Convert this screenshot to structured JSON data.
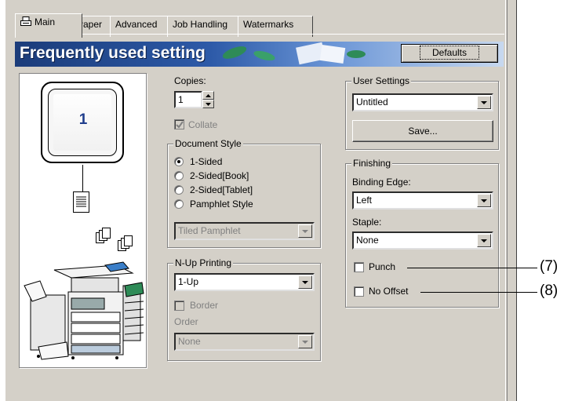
{
  "tabs": [
    {
      "label": "Main",
      "active": true
    },
    {
      "label": "Paper"
    },
    {
      "label": "Advanced"
    },
    {
      "label": "Job Handling"
    },
    {
      "label": "Watermarks"
    }
  ],
  "banner": {
    "title": "Frequently used setting",
    "defaults_label": "Defaults"
  },
  "preview": {
    "page_number": "1"
  },
  "copies": {
    "label": "Copies:",
    "value": "1"
  },
  "collate": {
    "label": "Collate",
    "checked": true,
    "enabled": false
  },
  "document_style": {
    "legend": "Document Style",
    "options": [
      "1-Sided",
      "2-Sided[Book]",
      "2-Sided[Tablet]",
      "Pamphlet Style"
    ],
    "selected": "1-Sided",
    "pamphlet_value": "Tiled Pamphlet"
  },
  "nup": {
    "legend": "N-Up Printing",
    "value": "1-Up",
    "border_label": "Border",
    "order_label": "Order",
    "order_value": "None"
  },
  "user_settings": {
    "legend": "User Settings",
    "value": "Untitled",
    "save_label": "Save..."
  },
  "finishing": {
    "legend": "Finishing",
    "binding_label": "Binding Edge:",
    "binding_value": "Left",
    "staple_label": "Staple:",
    "staple_value": "None",
    "punch_label": "Punch",
    "no_offset_label": "No Offset"
  },
  "callouts": {
    "punch": "(7)",
    "no_offset": "(8)"
  },
  "colors": {
    "dialog_bg": "#d4d0c8",
    "banner_start": "#1b3c7a",
    "banner_end": "#c7d8ef",
    "page_number": "#1f3d8c"
  }
}
